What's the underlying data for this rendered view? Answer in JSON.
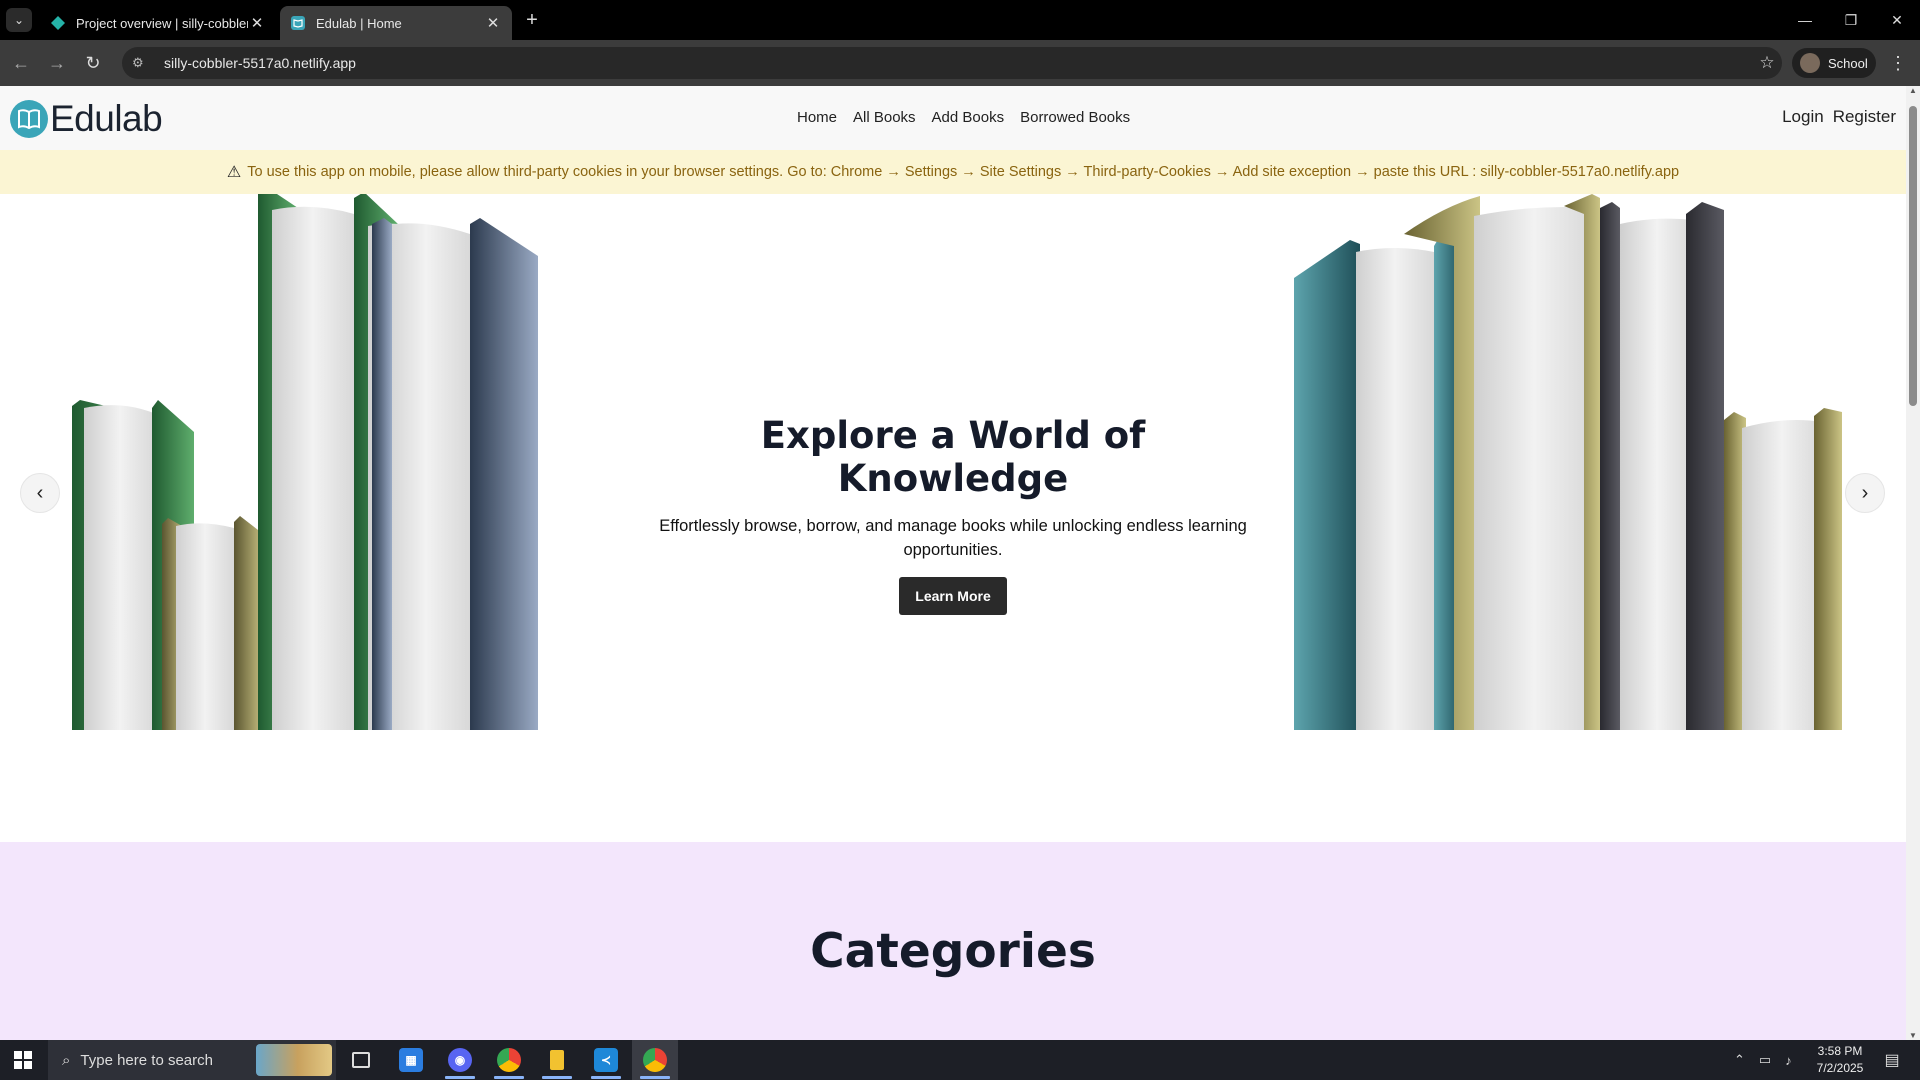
{
  "browser": {
    "tabs": [
      {
        "title": "Project overview | silly-cobbler-",
        "close": "✕"
      },
      {
        "title": "Edulab | Home",
        "close": "✕"
      }
    ],
    "new_tab": "+",
    "url": "silly-cobbler-5517a0.netlify.app",
    "profile_name": "School",
    "window": {
      "minimize": "—",
      "restore": "❐",
      "close": "✕"
    }
  },
  "site": {
    "brand": "Edulab",
    "menu": [
      "Home",
      "All Books",
      "Add Books",
      "Borrowed Books"
    ],
    "auth": {
      "login": "Login",
      "register": "Register"
    },
    "notice": "To use this app on mobile, please allow third-party cookies in your browser settings. Go to: Chrome → Settings → Site Settings → Third-party-Cookies → Add site exception → paste this URL : silly-cobbler-5517a0.netlify.app",
    "hero": {
      "title": "Explore a World of Knowledge",
      "subtitle": "Effortlessly browse, borrow, and manage books while unlocking endless learning opportunities.",
      "button": "Learn More",
      "prev": "‹",
      "next": "›"
    },
    "categories_heading": "Categories"
  },
  "taskbar": {
    "search_placeholder": "Type here to search",
    "time": "3:58 PM",
    "date": "7/2/2025"
  },
  "colors": {
    "notice_bg": "#fbf5d3",
    "notice_text": "#8a6410",
    "categories_bg": "#f3e6fc",
    "button_bg": "#2a2a2a",
    "logo": "#3aa5b8"
  }
}
